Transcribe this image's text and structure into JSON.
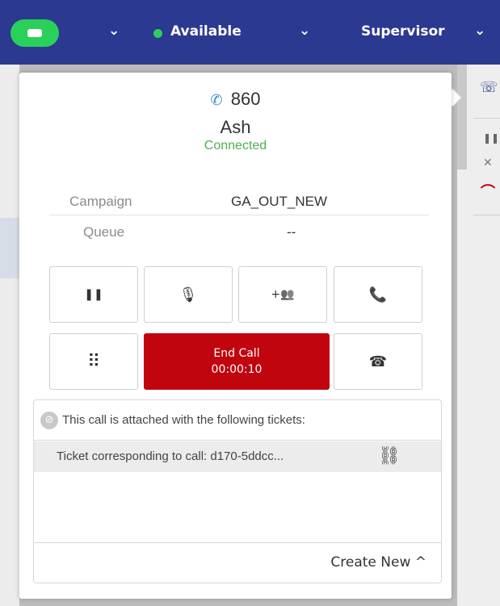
{
  "topbar": {
    "status_label": "Available",
    "role_label": "Supervisor",
    "bg_color": "#2b3990",
    "status_color": "#2bd05a",
    "chevron_glyph": "⌄",
    "role_chevron_glyph": "⌄"
  },
  "call": {
    "number": "860",
    "name": "Ash",
    "status": "Connected",
    "phone_icon": "phone-icon"
  },
  "info": {
    "campaign_label": "Campaign",
    "campaign_value": "GA_OUT_NEW",
    "queue_label": "Queue",
    "queue_value": "--"
  },
  "controls": {
    "hold_glyph": "❚❚",
    "mute_glyph": "🎙",
    "conference_glyph": "+👥",
    "transfer_glyph": "📞",
    "dialpad_glyph": "⠿",
    "end_call_label": "End Call",
    "end_call_timer": "00:00:10",
    "end_call_color": "#c0050f",
    "park_glyph": "☎"
  },
  "tickets": {
    "title": "This call is attached with the following tickets:",
    "items": [
      {
        "label": "Ticket corresponding to call: d170-5ddcc..."
      }
    ],
    "create_new_label": "Create New ^"
  }
}
